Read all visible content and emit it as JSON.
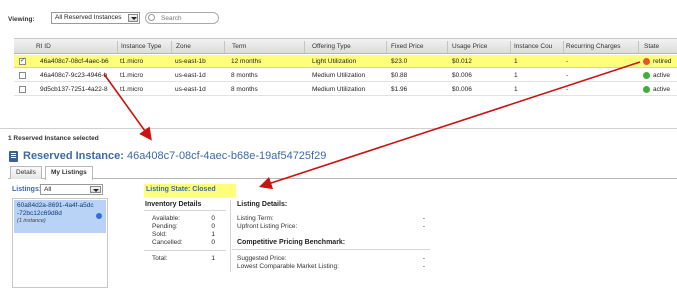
{
  "toolbar": {
    "viewing_label": "Viewing:",
    "viewing_value": "All Reserved Instances",
    "search_placeholder": "Search"
  },
  "table": {
    "columns": [
      "RI ID",
      "Instance Type",
      "Zone",
      "Term",
      "Offering Type",
      "Fixed Price",
      "Usage Price",
      "Instance Cou",
      "Recurring Charges",
      "State"
    ],
    "rows": [
      {
        "checked": true,
        "id": "46a408c7-08cf-4aec-b6",
        "type": "t1.micro",
        "zone": "us-east-1b",
        "term": "12 months",
        "offering": "Light Utilization",
        "fixed": "$23.0",
        "usage": "$0.012",
        "count": "1",
        "recurring": "-",
        "state": "retired",
        "state_color": "#e8542a"
      },
      {
        "checked": false,
        "id": "46a408c7-9c23-4946-b",
        "type": "t1.micro",
        "zone": "us-east-1d",
        "term": "8 months",
        "offering": "Medium Utilization",
        "fixed": "$0.88",
        "usage": "$0.006",
        "count": "1",
        "recurring": "-",
        "state": "active",
        "state_color": "#3fae3a"
      },
      {
        "checked": false,
        "id": "9d5cb137-7251-4a22-8",
        "type": "t1.micro",
        "zone": "us-east-1d",
        "term": "8 months",
        "offering": "Medium Utilization",
        "fixed": "$1.96",
        "usage": "$0.006",
        "count": "1",
        "recurring": "-",
        "state": "active",
        "state_color": "#3fae3a"
      }
    ]
  },
  "selection": {
    "count_text": "1 Reserved Instance selected",
    "title_prefix": "Reserved Instance:",
    "title_id": "46a408c7-08cf-4aec-b68e-19af54725f29"
  },
  "tabs": [
    "Details",
    "My Listings"
  ],
  "listings": {
    "label": "Listings:",
    "filter_value": "All",
    "items": [
      {
        "id": "60a84d2a-8691-4a4f-a5dc-72bc12c69d8d",
        "sub": "(1 instance)"
      }
    ]
  },
  "listing_state": "Listing State: Closed",
  "inventory": {
    "heading": "Inventory Details",
    "rows": [
      {
        "label": "Available:",
        "value": "0"
      },
      {
        "label": "Pending:",
        "value": "0"
      },
      {
        "label": "Sold:",
        "value": "1"
      },
      {
        "label": "Cancelled:",
        "value": "0"
      }
    ],
    "total_label": "Total:",
    "total_value": "1"
  },
  "listing_details": {
    "heading": "Listing Details:",
    "rows": [
      {
        "label": "Listing Term:",
        "value": "-"
      },
      {
        "label": "Upfront Listing Price:",
        "value": "-"
      }
    ]
  },
  "benchmark": {
    "heading": "Competitive Pricing Benchmark:",
    "rows": [
      {
        "label": "Suggested Price:",
        "value": "-"
      },
      {
        "label": "Lowest Comparable Market Listing:",
        "value": "-"
      }
    ]
  },
  "colors": {
    "highlight": "#fdff7a",
    "arrow": "#cc1111",
    "link_blue": "#3d6aa5"
  }
}
